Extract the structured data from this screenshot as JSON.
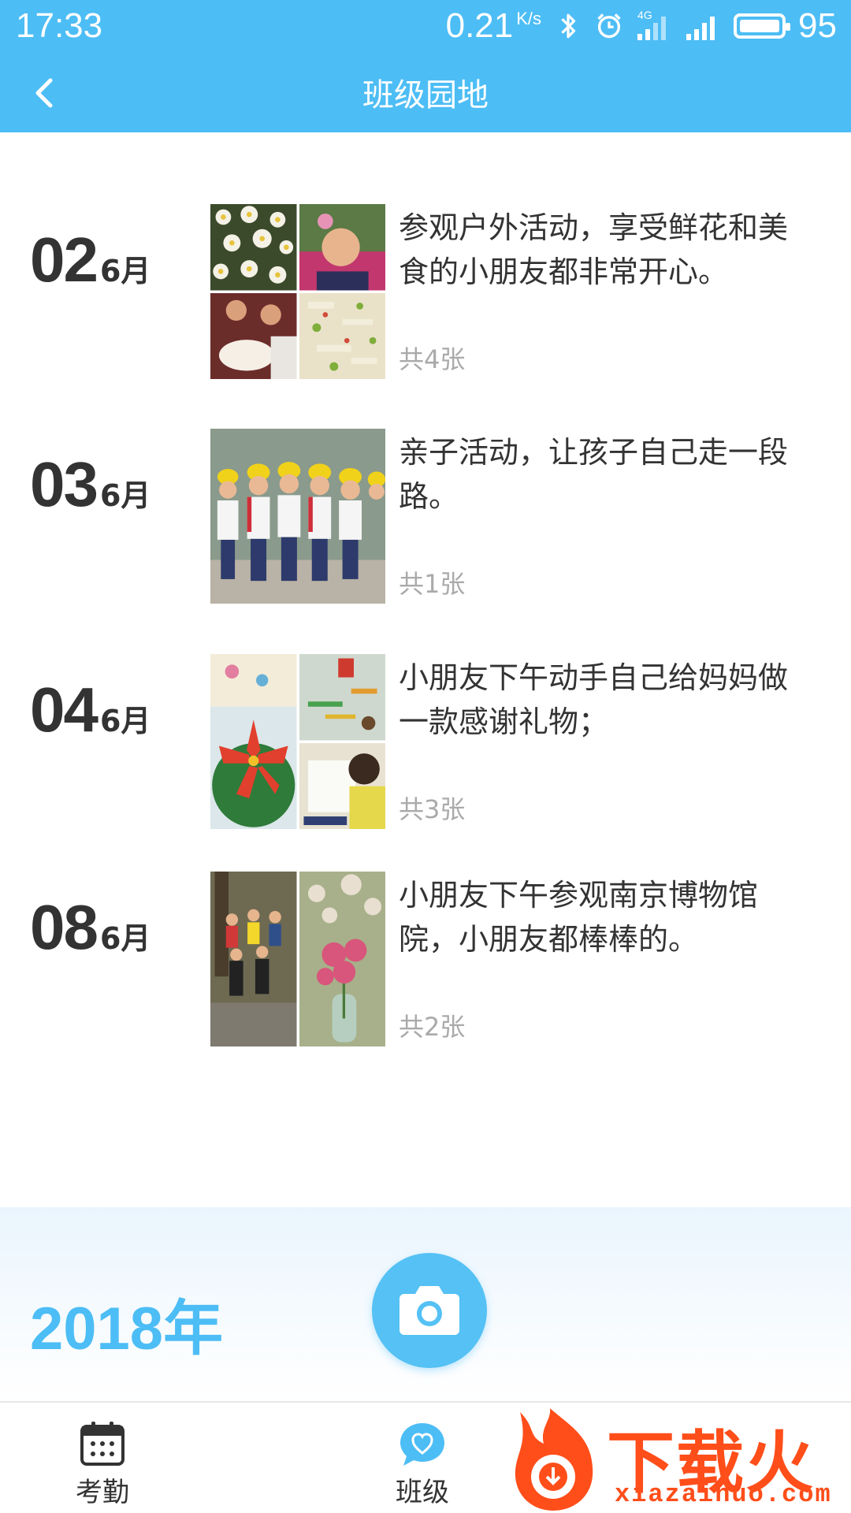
{
  "status_bar": {
    "time": "17:33",
    "speed": "0.21",
    "speed_unit": "K/s",
    "network": "4G",
    "battery": "95"
  },
  "header": {
    "title": "班级园地",
    "back_icon": "chevron-left-icon"
  },
  "entries": [
    {
      "day": "02",
      "month": "6月",
      "description": "参观户外活动，享受鲜花和美食的小朋友都非常开心。",
      "count_label": "共4张",
      "photos": [
        "daisies-photo",
        "child-smiling-photo",
        "birthday-cake-photo",
        "salad-food-photo"
      ]
    },
    {
      "day": "03",
      "month": "6月",
      "description": "亲子活动，让孩子自己走一段路。",
      "count_label": "共1张",
      "photos": [
        "children-group-yellow-hats-photo"
      ]
    },
    {
      "day": "04",
      "month": "6月",
      "description": "小朋友下午动手自己给妈妈做一款感谢礼物；",
      "count_label": "共3张",
      "photos": [
        "paper-flower-craft-photo",
        "craft-table-photo",
        "child-painting-photo"
      ]
    },
    {
      "day": "08",
      "month": "6月",
      "description": "小朋友下午参观南京博物馆院，小朋友都棒棒的。",
      "count_label": "共2张",
      "photos": [
        "children-outdoor-group-photo",
        "pink-flowers-vase-photo"
      ]
    }
  ],
  "year_bar": {
    "year": "2018",
    "unit": "年",
    "camera_icon": "camera-icon"
  },
  "bottom_nav": {
    "items": [
      {
        "label": "考勤",
        "icon": "calendar-icon"
      },
      {
        "label": "班级",
        "icon": "heart-chat-icon"
      }
    ]
  },
  "watermark": {
    "text": "下载火",
    "domain": "xiazaihuo.com"
  },
  "colors": {
    "brand": "#4dbdf5",
    "text": "#333333",
    "muted": "#aaaaaa",
    "watermark": "#ff4e1a"
  }
}
